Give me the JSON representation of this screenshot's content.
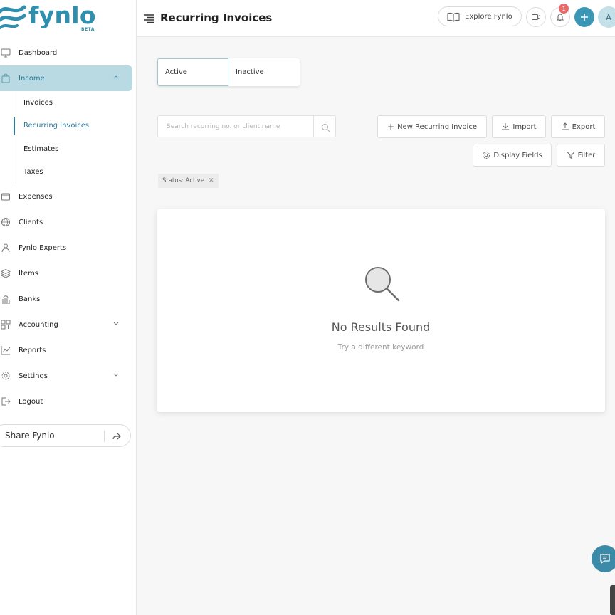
{
  "brand": {
    "name": "fynlo",
    "tag": "BETA",
    "color": "#2f8fae"
  },
  "header": {
    "title": "Recurring Invoices",
    "explore_label": "Explore Fynlo",
    "notification_count": "1",
    "avatar_initial": "A"
  },
  "sidebar": {
    "items": [
      {
        "label": "Dashboard",
        "icon": "monitor-icon"
      },
      {
        "label": "Income",
        "icon": "bag-icon"
      },
      {
        "label": "Expenses",
        "icon": "wallet-icon"
      },
      {
        "label": "Clients",
        "icon": "globe-icon"
      },
      {
        "label": "Fynlo Experts",
        "icon": "person-icon"
      },
      {
        "label": "Items",
        "icon": "layers-icon"
      },
      {
        "label": "Banks",
        "icon": "bank-icon"
      },
      {
        "label": "Accounting",
        "icon": "grid-icon"
      },
      {
        "label": "Reports",
        "icon": "chart-icon"
      },
      {
        "label": "Settings",
        "icon": "gear-icon"
      },
      {
        "label": "Logout",
        "icon": "logout-icon"
      }
    ],
    "income_sub": [
      "Invoices",
      "Recurring Invoices",
      "Estimates",
      "Taxes"
    ],
    "share_label": "Share Fynlo"
  },
  "tabs": [
    "Active",
    "Inactive"
  ],
  "search": {
    "placeholder": "Search recurring no. or client name",
    "value": ""
  },
  "actions": {
    "new_label": "New Recurring Invoice",
    "import_label": "Import",
    "export_label": "Export",
    "display_fields_label": "Display Fields",
    "filter_label": "Filter"
  },
  "filter_chip": "Status: Active",
  "empty_state": {
    "title": "No Results Found",
    "subtitle": "Try a different keyword"
  },
  "colors": {
    "accent": "#3b97b5",
    "active_bg": "#b9d9e3",
    "badge": "#e86a6a"
  }
}
